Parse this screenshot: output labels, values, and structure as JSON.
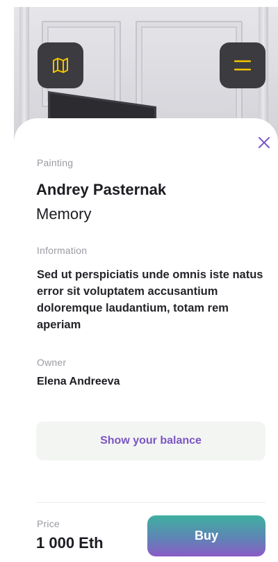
{
  "hero": {
    "map_icon": "map-icon",
    "menu_icon": "hamburger-menu-icon",
    "icon_color": "#f5c400"
  },
  "sheet": {
    "close_icon": "close-icon",
    "close_color": "#7b55c2",
    "category_label": "Painting",
    "artist": "Andrey Pasternak",
    "artwork_title": "Memory",
    "information_label": "Information",
    "information_text": "Sed ut perspiciatis unde omnis iste natus error sit voluptatem accusantium doloremque laudantium, totam rem aperiam",
    "owner_label": "Owner",
    "owner_name": "Elena Andreeva",
    "balance_button": "Show your balance"
  },
  "footer": {
    "price_label": "Price",
    "price_value": "1 000 Eth",
    "buy_button": "Buy"
  }
}
